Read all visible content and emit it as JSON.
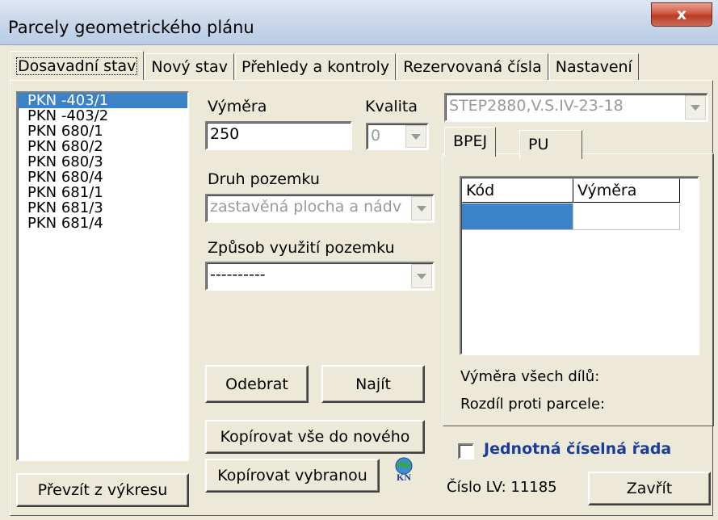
{
  "window": {
    "title": "Parcely geometrického plánu",
    "close_label": "x"
  },
  "tabs": [
    {
      "label": "Dosavadní stav",
      "active": true
    },
    {
      "label": "Nový stav",
      "active": false
    },
    {
      "label": "Přehledy a kontroly",
      "active": false
    },
    {
      "label": "Rezervovaná čísla",
      "active": false
    },
    {
      "label": "Nastavení",
      "active": false
    }
  ],
  "parcels": {
    "selected_index": 0,
    "items": [
      "PKN -403/1",
      "PKN -403/2",
      "PKN 680/1",
      "PKN 680/2",
      "PKN 680/3",
      "PKN 680/4",
      "PKN 681/1",
      "PKN 681/3",
      "PKN 681/4"
    ]
  },
  "form": {
    "vymera_label": "Výměra",
    "vymera_value": "250",
    "kvalita_label": "Kvalita",
    "kvalita_value": "0",
    "druh_label": "Druh pozemku",
    "druh_value": "zastavěná plocha a nádv",
    "zpusob_label": "Způsob využití pozemku",
    "zpusob_value": "----------",
    "step_value": "STEP2880,V.S.IV-23-18"
  },
  "subtabs": [
    {
      "label": "BPEJ",
      "active": true
    },
    {
      "label": "PU",
      "active": false
    }
  ],
  "grid": {
    "columns": [
      "Kód",
      "Výměra"
    ],
    "rows": [
      [
        "",
        ""
      ]
    ]
  },
  "summary": {
    "vymera_vsech_dilu": "Výměra všech dílů:",
    "rozdil_proti_parcele": "Rozdíl proti parcele:"
  },
  "buttons": {
    "odebrat": "Odebrat",
    "najit": "Najít",
    "kopirovat_vse": "Kopírovat vše do nového",
    "kopirovat_vybranou": "Kopírovat vybranou",
    "prevzit": "Převzít z výkresu",
    "zavrit": "Zavřít"
  },
  "checkbox": {
    "label": "Jednotná číselná řada",
    "checked": false
  },
  "status": {
    "cislo_lv": "Číslo LV: 11185"
  },
  "colors": {
    "selection": "#3b82c8",
    "accent_label": "#1a3d9a",
    "window_bg": "#ece9d8"
  },
  "icons": {
    "kn_icon": "KN"
  }
}
